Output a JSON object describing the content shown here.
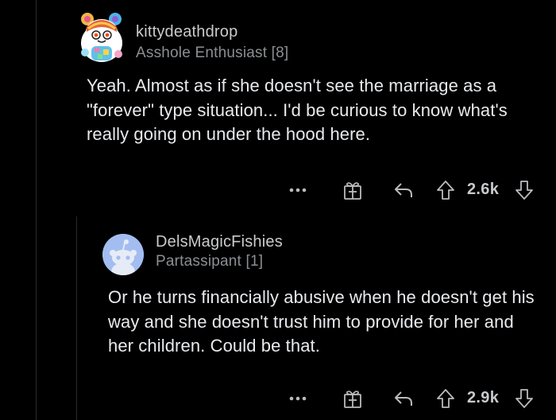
{
  "comments": [
    {
      "username": "kittydeathdrop",
      "flair": "Asshole Enthusiast [8]",
      "body": "Yeah. Almost as if she doesn't see the marriage as a \"forever\" type situation... I'd be curious to know what's really going on under the hood here.",
      "score": "2.6k",
      "avatar": "snoo-avatar-rainbow-bear-ears"
    },
    {
      "username": "DelsMagicFishies",
      "flair": "Partassipant [1]",
      "body": "Or he turns financially abusive when he doesn't get his way and she doesn't trust him to provide for her and her children. Could be that.",
      "score": "2.9k",
      "avatar": "default-snoo-avatar"
    }
  ],
  "icons": {
    "more": "more-options-icon",
    "award": "award-gift-icon",
    "reply": "reply-arrow-icon",
    "upvote": "upvote-arrow-icon",
    "downvote": "downvote-arrow-icon"
  },
  "colors": {
    "background": "#000000",
    "text": "#e8eaed",
    "meta": "#8c8f92",
    "thread_line": "#2a2a2b",
    "default_avatar_bg": "#a3bdf0"
  }
}
